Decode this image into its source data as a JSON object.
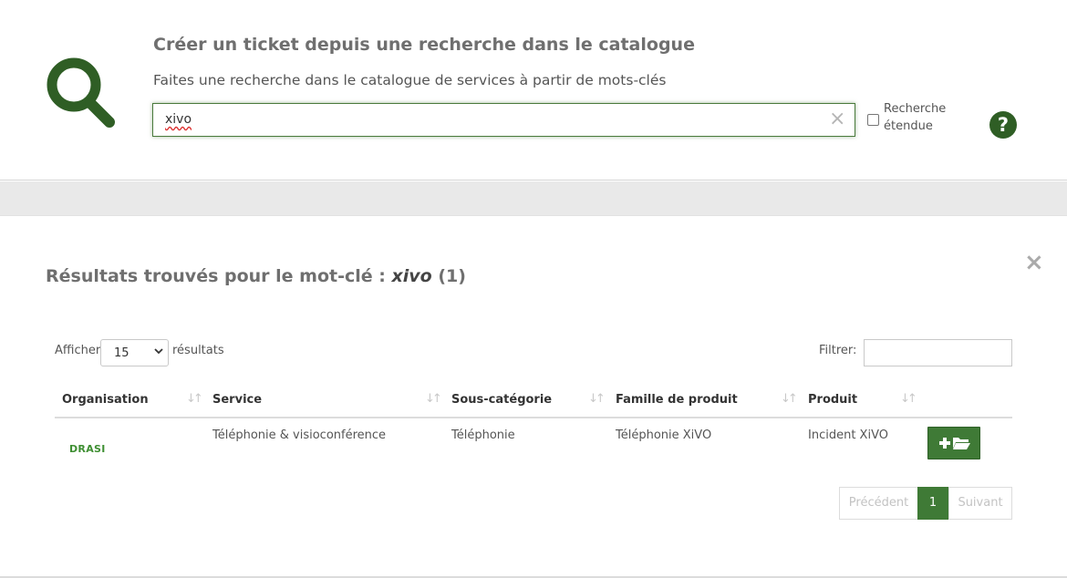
{
  "header": {
    "title": "Créer un ticket depuis une recherche dans le catalogue",
    "subtitle": "Faites une recherche dans le catalogue de services à partir de mots-clés"
  },
  "search": {
    "value": "xivo",
    "extended_label": "Recherche étendue",
    "extended_checked": false
  },
  "results": {
    "title_prefix": "Résultats trouvés pour le mot-clé :",
    "keyword": "xivo",
    "count": "(1)",
    "show_label": "Afficher",
    "page_size": "15",
    "show_after": "résultats",
    "filter_label": "Filtrer:",
    "filter_value": "",
    "columns": [
      "Organisation",
      "Service",
      "Sous-catégorie",
      "Famille de produit",
      "Produit"
    ],
    "rows": [
      {
        "organisation": "DRASI",
        "service": "Téléphonie & visioconférence",
        "sous_categorie": "Téléphonie",
        "famille": "Téléphonie XiVO",
        "produit": "Incident XiVO"
      }
    ],
    "pagination": {
      "prev": "Précédent",
      "current": "1",
      "next": "Suivant"
    }
  },
  "icons": {
    "search": "magnifier-icon",
    "clear": "close-icon",
    "help": "question-icon",
    "add_ticket": "plus-folder-icon"
  },
  "colors": {
    "brand_green": "#2f5e25",
    "button_green": "#3f7a36",
    "org_green": "#3f8f33"
  }
}
